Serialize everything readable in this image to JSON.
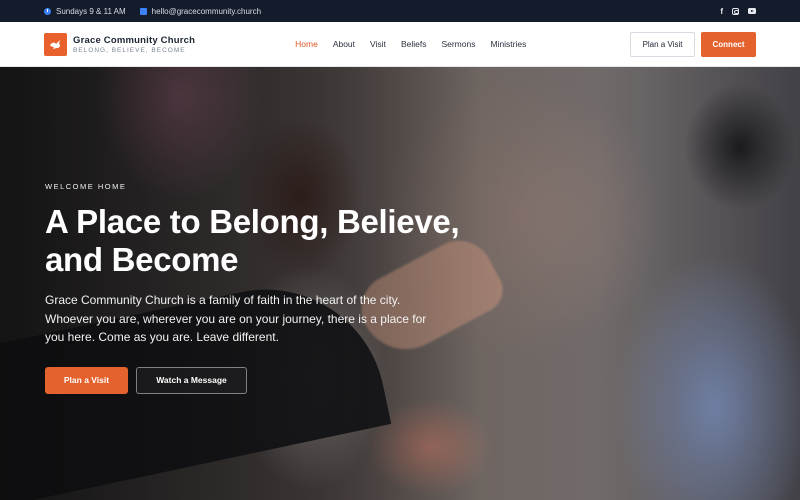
{
  "topbar": {
    "service_times": "Sundays 9 & 11 AM",
    "email": "hello@gracecommunity.church",
    "social_icons": [
      "facebook-icon",
      "instagram-icon",
      "youtube-icon"
    ]
  },
  "header": {
    "logo_title": "Grace Community Church",
    "logo_tagline": "BELONG, BELIEVE, BECOME",
    "nav": [
      {
        "label": "Home",
        "active": true
      },
      {
        "label": "About",
        "active": false
      },
      {
        "label": "Visit",
        "active": false
      },
      {
        "label": "Beliefs",
        "active": false
      },
      {
        "label": "Sermons",
        "active": false
      },
      {
        "label": "Ministries",
        "active": false
      }
    ],
    "plan_visit_label": "Plan a Visit",
    "connect_label": "Connect"
  },
  "hero": {
    "eyebrow": "WELCOME HOME",
    "headline": "A Place to Belong, Believe, and Become",
    "lead": "Grace Community Church is a family of faith in the heart of the city. Whoever you are, wherever you are on your journey, there is a place for you here. Come as you are. Leave different.",
    "primary_cta": "Plan a Visit",
    "secondary_cta": "Watch a Message"
  },
  "colors": {
    "accent": "#e4622e",
    "topbar_bg": "#141c2b",
    "icon_blue": "#3b82f6"
  }
}
